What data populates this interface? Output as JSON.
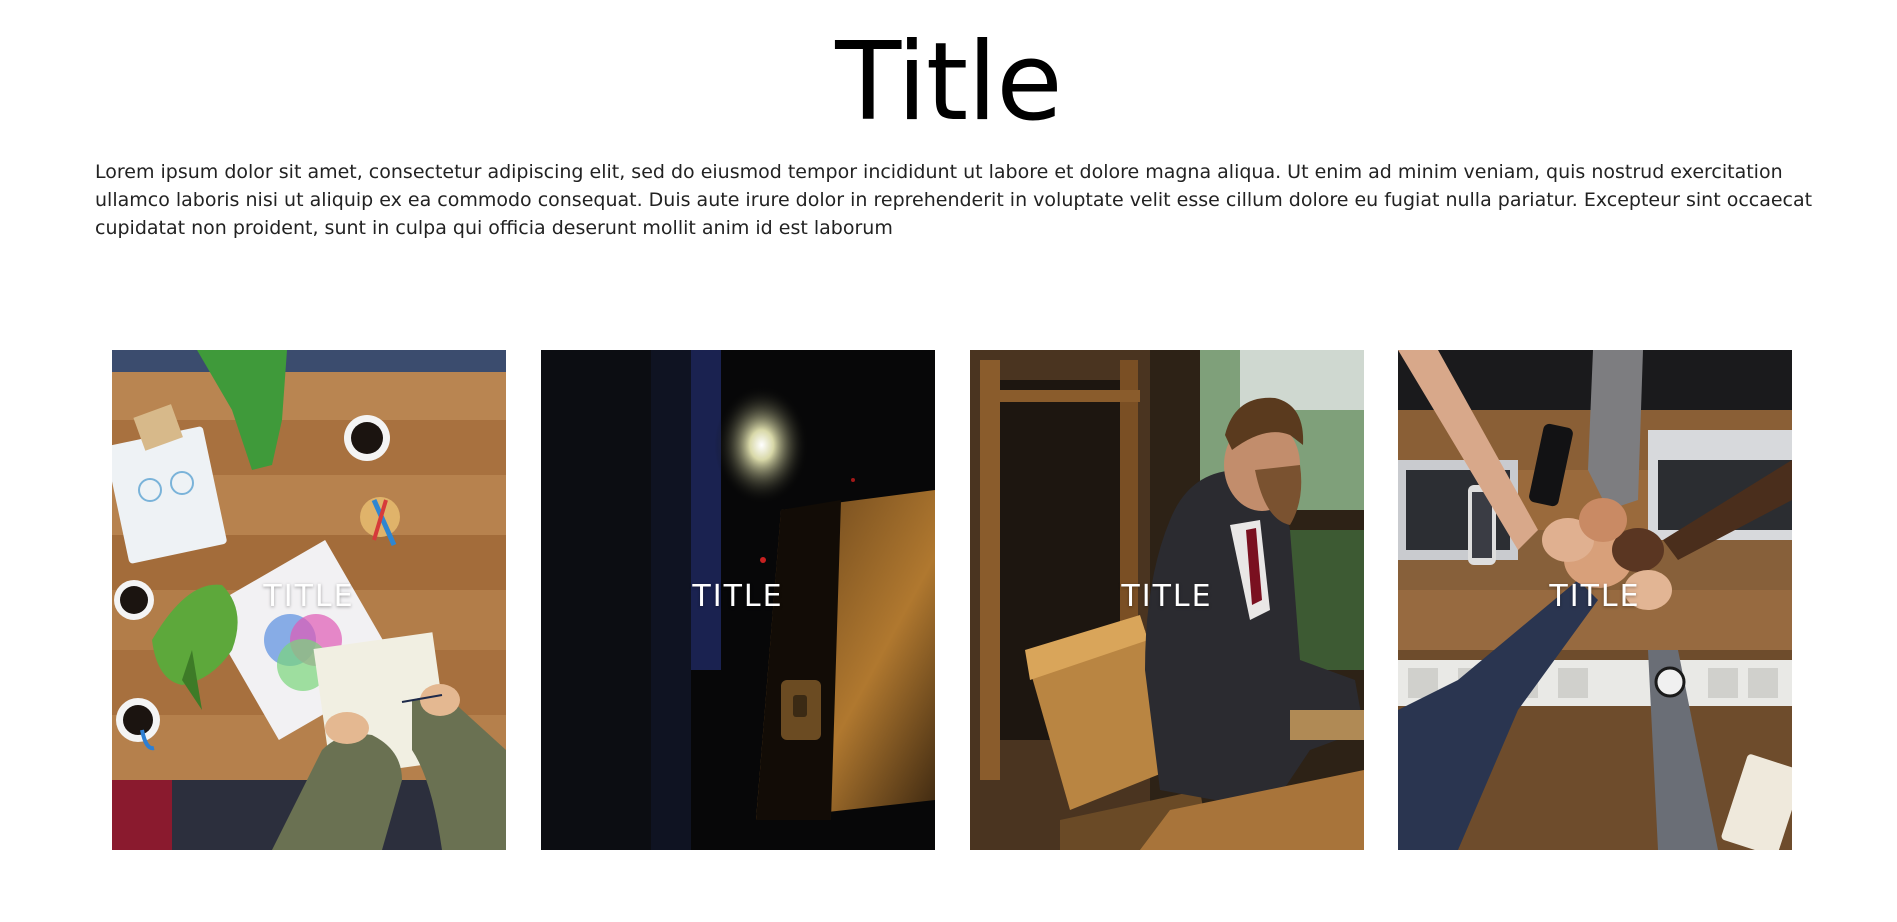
{
  "header": {
    "title": "Title"
  },
  "intro": {
    "text": "Lorem ipsum dolor sit amet, consectetur adipiscing elit, sed do eiusmod tempor incididunt ut labore et dolore magna aliqua. Ut enim ad minim veniam, quis nostrud exercitation ullamco laboris nisi ut aliquip ex ea commodo consequat. Duis aute irure dolor in reprehenderit in voluptate velit esse cillum dolore eu fugiat nulla pariatur. Excepteur sint occaecat cupidatat non proident, sunt in culpa qui officia deserunt mollit anim id est laborum"
  },
  "cards": [
    {
      "title": "TITLE",
      "image": "team-meeting-desk-photo"
    },
    {
      "title": "TITLE",
      "image": "dark-interior-photo"
    },
    {
      "title": "TITLE",
      "image": "businessman-working-photo"
    },
    {
      "title": "TITLE",
      "image": "team-fist-bump-photo"
    }
  ],
  "colors": {
    "background": "#ffffff",
    "title_text": "#000000",
    "body_text": "#222222",
    "card_title_text": "#ffffff"
  }
}
